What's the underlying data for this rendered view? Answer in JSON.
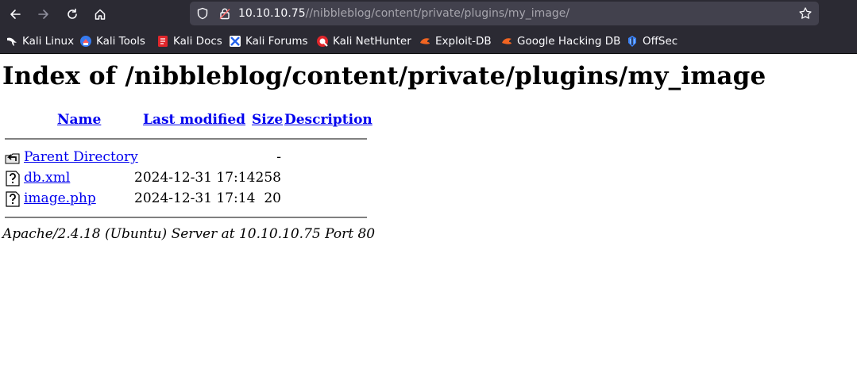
{
  "browser": {
    "url_host": "10.10.10.75",
    "url_path": "//nibbleblog/content/private/plugins/my_image/",
    "bookmarks": [
      {
        "label": "Kali Linux",
        "icon": "kali-dragon-icon"
      },
      {
        "label": "Kali Tools",
        "icon": "kali-tools-icon"
      },
      {
        "label": "Kali Docs",
        "icon": "kali-docs-icon"
      },
      {
        "label": "Kali Forums",
        "icon": "kali-forums-icon"
      },
      {
        "label": "Kali NetHunter",
        "icon": "nethunter-icon"
      },
      {
        "label": "Exploit-DB",
        "icon": "exploit-db-icon"
      },
      {
        "label": "Google Hacking DB",
        "icon": "ghdb-icon"
      },
      {
        "label": "OffSec",
        "icon": "offsec-icon"
      }
    ]
  },
  "page": {
    "title": "Index of /nibbleblog/content/private/plugins/my_image",
    "columns": {
      "name": "Name",
      "modified": "Last modified",
      "size": "Size",
      "description": "Description"
    },
    "rows": [
      {
        "name": "Parent Directory",
        "modified": "",
        "size": "-",
        "icon": "back-folder-icon"
      },
      {
        "name": "db.xml",
        "modified": "2024-12-31 17:14",
        "size": "258",
        "icon": "unknown-file-icon"
      },
      {
        "name": "image.php",
        "modified": "2024-12-31 17:14",
        "size": "20",
        "icon": "unknown-file-icon"
      }
    ],
    "footer": "Apache/2.4.18 (Ubuntu) Server at 10.10.10.75 Port 80"
  }
}
